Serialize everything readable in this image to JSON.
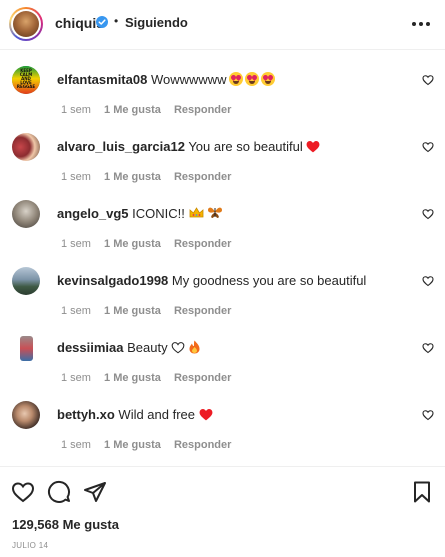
{
  "header": {
    "username": "chiquis",
    "separator": "•",
    "follow_state": "Siguiendo"
  },
  "comments": [
    {
      "username": "elfantasmita08",
      "text": "Wowwwwww",
      "emoji": [
        "heart-eyes",
        "heart-eyes",
        "heart-eyes"
      ],
      "avatar_text": [
        "KEEP",
        "CALM",
        "AND",
        "LOVE",
        "REGGAE"
      ],
      "time": "1 sem",
      "likes": "1 Me gusta",
      "reply": "Responder"
    },
    {
      "username": "alvaro_luis_garcia12",
      "text": "You are so beautiful",
      "emoji": [
        "red-heart"
      ],
      "time": "1 sem",
      "likes": "1 Me gusta",
      "reply": "Responder"
    },
    {
      "username": "angelo_vg5",
      "text": "ICONIC!!",
      "emoji": [
        "crown",
        "butterfly"
      ],
      "time": "1 sem",
      "likes": "1 Me gusta",
      "reply": "Responder"
    },
    {
      "username": "kevinsalgado1998",
      "text": "My goodness you are so beautiful",
      "emoji": [],
      "time": "1 sem",
      "likes": "1 Me gusta",
      "reply": "Responder"
    },
    {
      "username": "dessiimiaa",
      "text": "Beauty",
      "emoji": [
        "white-heart",
        "fire"
      ],
      "time": "1 sem",
      "likes": "1 Me gusta",
      "reply": "Responder"
    },
    {
      "username": "bettyh.xo",
      "text": "Wild and free",
      "emoji": [
        "red-heart"
      ],
      "time": "1 sem",
      "likes": "1 Me gusta",
      "reply": "Responder"
    }
  ],
  "footer": {
    "likes_count": "129,568 Me gusta",
    "date": "JULIO 14"
  },
  "icons": {
    "like": "heart-outline-icon",
    "comment": "comment-bubble-icon",
    "share": "paper-plane-icon",
    "save": "bookmark-icon",
    "more": "more-horizontal-icon",
    "verified": "verified-badge-icon"
  },
  "colors": {
    "text": "#262626",
    "secondary": "#8e8e8e",
    "verified": "#3897f0",
    "heart_red": "#ed1c24",
    "divider": "#efefef"
  }
}
